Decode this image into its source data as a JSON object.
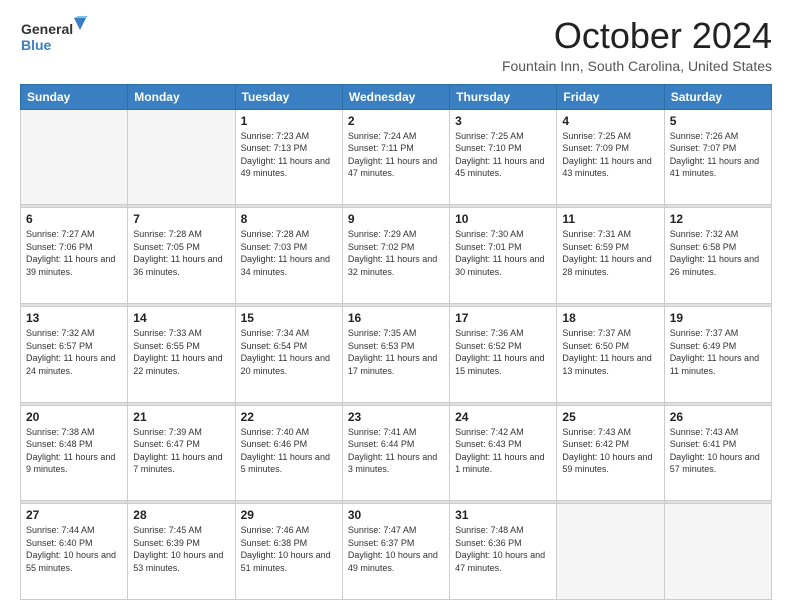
{
  "logo": {
    "general": "General",
    "blue": "Blue"
  },
  "header": {
    "month": "October 2024",
    "location": "Fountain Inn, South Carolina, United States"
  },
  "days_of_week": [
    "Sunday",
    "Monday",
    "Tuesday",
    "Wednesday",
    "Thursday",
    "Friday",
    "Saturday"
  ],
  "weeks": [
    [
      {
        "day": "",
        "sunrise": "",
        "sunset": "",
        "daylight": ""
      },
      {
        "day": "",
        "sunrise": "",
        "sunset": "",
        "daylight": ""
      },
      {
        "day": "1",
        "sunrise": "Sunrise: 7:23 AM",
        "sunset": "Sunset: 7:13 PM",
        "daylight": "Daylight: 11 hours and 49 minutes."
      },
      {
        "day": "2",
        "sunrise": "Sunrise: 7:24 AM",
        "sunset": "Sunset: 7:11 PM",
        "daylight": "Daylight: 11 hours and 47 minutes."
      },
      {
        "day": "3",
        "sunrise": "Sunrise: 7:25 AM",
        "sunset": "Sunset: 7:10 PM",
        "daylight": "Daylight: 11 hours and 45 minutes."
      },
      {
        "day": "4",
        "sunrise": "Sunrise: 7:25 AM",
        "sunset": "Sunset: 7:09 PM",
        "daylight": "Daylight: 11 hours and 43 minutes."
      },
      {
        "day": "5",
        "sunrise": "Sunrise: 7:26 AM",
        "sunset": "Sunset: 7:07 PM",
        "daylight": "Daylight: 11 hours and 41 minutes."
      }
    ],
    [
      {
        "day": "6",
        "sunrise": "Sunrise: 7:27 AM",
        "sunset": "Sunset: 7:06 PM",
        "daylight": "Daylight: 11 hours and 39 minutes."
      },
      {
        "day": "7",
        "sunrise": "Sunrise: 7:28 AM",
        "sunset": "Sunset: 7:05 PM",
        "daylight": "Daylight: 11 hours and 36 minutes."
      },
      {
        "day": "8",
        "sunrise": "Sunrise: 7:28 AM",
        "sunset": "Sunset: 7:03 PM",
        "daylight": "Daylight: 11 hours and 34 minutes."
      },
      {
        "day": "9",
        "sunrise": "Sunrise: 7:29 AM",
        "sunset": "Sunset: 7:02 PM",
        "daylight": "Daylight: 11 hours and 32 minutes."
      },
      {
        "day": "10",
        "sunrise": "Sunrise: 7:30 AM",
        "sunset": "Sunset: 7:01 PM",
        "daylight": "Daylight: 11 hours and 30 minutes."
      },
      {
        "day": "11",
        "sunrise": "Sunrise: 7:31 AM",
        "sunset": "Sunset: 6:59 PM",
        "daylight": "Daylight: 11 hours and 28 minutes."
      },
      {
        "day": "12",
        "sunrise": "Sunrise: 7:32 AM",
        "sunset": "Sunset: 6:58 PM",
        "daylight": "Daylight: 11 hours and 26 minutes."
      }
    ],
    [
      {
        "day": "13",
        "sunrise": "Sunrise: 7:32 AM",
        "sunset": "Sunset: 6:57 PM",
        "daylight": "Daylight: 11 hours and 24 minutes."
      },
      {
        "day": "14",
        "sunrise": "Sunrise: 7:33 AM",
        "sunset": "Sunset: 6:55 PM",
        "daylight": "Daylight: 11 hours and 22 minutes."
      },
      {
        "day": "15",
        "sunrise": "Sunrise: 7:34 AM",
        "sunset": "Sunset: 6:54 PM",
        "daylight": "Daylight: 11 hours and 20 minutes."
      },
      {
        "day": "16",
        "sunrise": "Sunrise: 7:35 AM",
        "sunset": "Sunset: 6:53 PM",
        "daylight": "Daylight: 11 hours and 17 minutes."
      },
      {
        "day": "17",
        "sunrise": "Sunrise: 7:36 AM",
        "sunset": "Sunset: 6:52 PM",
        "daylight": "Daylight: 11 hours and 15 minutes."
      },
      {
        "day": "18",
        "sunrise": "Sunrise: 7:37 AM",
        "sunset": "Sunset: 6:50 PM",
        "daylight": "Daylight: 11 hours and 13 minutes."
      },
      {
        "day": "19",
        "sunrise": "Sunrise: 7:37 AM",
        "sunset": "Sunset: 6:49 PM",
        "daylight": "Daylight: 11 hours and 11 minutes."
      }
    ],
    [
      {
        "day": "20",
        "sunrise": "Sunrise: 7:38 AM",
        "sunset": "Sunset: 6:48 PM",
        "daylight": "Daylight: 11 hours and 9 minutes."
      },
      {
        "day": "21",
        "sunrise": "Sunrise: 7:39 AM",
        "sunset": "Sunset: 6:47 PM",
        "daylight": "Daylight: 11 hours and 7 minutes."
      },
      {
        "day": "22",
        "sunrise": "Sunrise: 7:40 AM",
        "sunset": "Sunset: 6:46 PM",
        "daylight": "Daylight: 11 hours and 5 minutes."
      },
      {
        "day": "23",
        "sunrise": "Sunrise: 7:41 AM",
        "sunset": "Sunset: 6:44 PM",
        "daylight": "Daylight: 11 hours and 3 minutes."
      },
      {
        "day": "24",
        "sunrise": "Sunrise: 7:42 AM",
        "sunset": "Sunset: 6:43 PM",
        "daylight": "Daylight: 11 hours and 1 minute."
      },
      {
        "day": "25",
        "sunrise": "Sunrise: 7:43 AM",
        "sunset": "Sunset: 6:42 PM",
        "daylight": "Daylight: 10 hours and 59 minutes."
      },
      {
        "day": "26",
        "sunrise": "Sunrise: 7:43 AM",
        "sunset": "Sunset: 6:41 PM",
        "daylight": "Daylight: 10 hours and 57 minutes."
      }
    ],
    [
      {
        "day": "27",
        "sunrise": "Sunrise: 7:44 AM",
        "sunset": "Sunset: 6:40 PM",
        "daylight": "Daylight: 10 hours and 55 minutes."
      },
      {
        "day": "28",
        "sunrise": "Sunrise: 7:45 AM",
        "sunset": "Sunset: 6:39 PM",
        "daylight": "Daylight: 10 hours and 53 minutes."
      },
      {
        "day": "29",
        "sunrise": "Sunrise: 7:46 AM",
        "sunset": "Sunset: 6:38 PM",
        "daylight": "Daylight: 10 hours and 51 minutes."
      },
      {
        "day": "30",
        "sunrise": "Sunrise: 7:47 AM",
        "sunset": "Sunset: 6:37 PM",
        "daylight": "Daylight: 10 hours and 49 minutes."
      },
      {
        "day": "31",
        "sunrise": "Sunrise: 7:48 AM",
        "sunset": "Sunset: 6:36 PM",
        "daylight": "Daylight: 10 hours and 47 minutes."
      },
      {
        "day": "",
        "sunrise": "",
        "sunset": "",
        "daylight": ""
      },
      {
        "day": "",
        "sunrise": "",
        "sunset": "",
        "daylight": ""
      }
    ]
  ]
}
